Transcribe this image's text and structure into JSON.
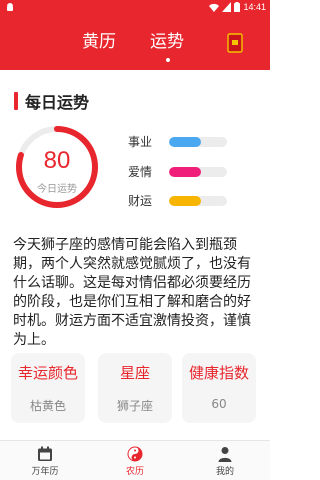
{
  "status_bar": {
    "time": "14:41"
  },
  "header": {
    "tabs": [
      {
        "label": "黄历",
        "active": false
      },
      {
        "label": "运势",
        "active": true
      }
    ]
  },
  "daily": {
    "section_title": "每日运势",
    "score": "80",
    "score_label": "今日运势",
    "score_fraction": 0.8,
    "metrics": [
      {
        "label": "事业",
        "color": "#4aa8f0",
        "level": 0.55
      },
      {
        "label": "爱情",
        "color": "#f0207a",
        "level": 0.55
      },
      {
        "label": "财运",
        "color": "#f7b500",
        "level": 0.55
      }
    ],
    "description": "今天狮子座的感情可能会陷入到瓶颈期，两个人突然就感觉腻烦了，也没有什么话聊。这是每对情侣都必须要经历的阶段，也是你们互相了解和磨合的好时机。财运方面不适宜激情投资，谨慎为上。"
  },
  "cards": [
    {
      "title": "幸运颜色",
      "value": "枯黄色"
    },
    {
      "title": "星座",
      "value": "狮子座"
    },
    {
      "title": "健康指数",
      "value": "60"
    }
  ],
  "bottom_nav": [
    {
      "label": "万年历",
      "icon": "calendar-icon",
      "active": false
    },
    {
      "label": "农历",
      "icon": "yin-yang-icon",
      "active": true
    },
    {
      "label": "我的",
      "icon": "person-icon",
      "active": false
    }
  ],
  "colors": {
    "primary": "#e8262d",
    "track": "#ececec"
  }
}
